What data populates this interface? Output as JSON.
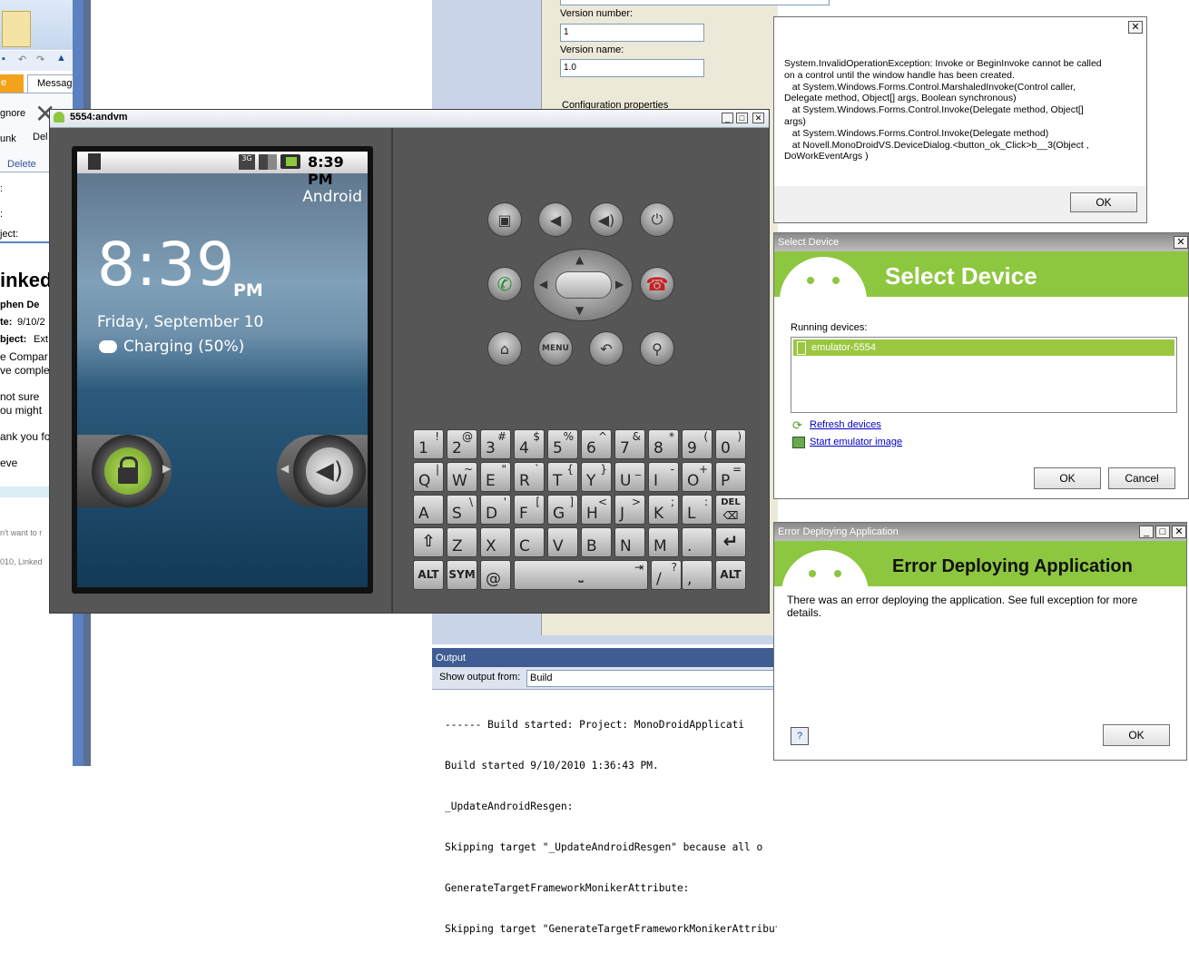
{
  "outlook": {
    "ribbon_tab": "Messag",
    "ignore_label": "gnore",
    "junk_label": "unk",
    "delete_icon_label": "Del",
    "group_delete": "Delete",
    "field_colon_1": ":",
    "field_colon_2": ":",
    "field_object": "ject:",
    "message_title": "inked",
    "from": "phen De",
    "date_label": "te:",
    "date_value": "9/10/2",
    "subject_label": "bject:",
    "subject_value": "Ext",
    "body_lines": [
      "e Compar",
      "ve comple",
      "",
      "not sure",
      "ou might",
      "",
      "ank you fo",
      "",
      "eve"
    ],
    "footer_1": "n't want to r",
    "footer_2": "010, Linked"
  },
  "project_props": {
    "version_number_label": "Version number:",
    "version_number_value": "1",
    "version_name_label": "Version name:",
    "version_name_value": "1.0",
    "config_label": "Configuration properties"
  },
  "output_pane": {
    "title": "Output",
    "show_from_label": "Show output from:",
    "show_from_value": "Build",
    "lines": [
      "------ Build started: Project: MonoDroidApplicati",
      "Build started 9/10/2010 1:36:43 PM.",
      "_UpdateAndroidResgen:",
      "Skipping target \"_UpdateAndroidResgen\" because all o",
      "GenerateTargetFrameworkMonikerAttribute:",
      "Skipping target \"GenerateTargetFrameworkMonikerAttribute\" because all output files are up-to-date with respect to the"
    ]
  },
  "emulator": {
    "window_title": "5554:andvm",
    "status_time": "8:39 PM",
    "carrier": "Android",
    "clock": "8:39",
    "ampm": "PM",
    "date": "Friday, September 10",
    "charging": "Charging (50%)",
    "menu_label": "MENU",
    "keys_row1": [
      [
        "1",
        "!"
      ],
      [
        "2",
        "@"
      ],
      [
        "3",
        "#"
      ],
      [
        "4",
        "$"
      ],
      [
        "5",
        "%"
      ],
      [
        "6",
        "^"
      ],
      [
        "7",
        "&"
      ],
      [
        "8",
        "*"
      ],
      [
        "9",
        "("
      ],
      [
        "0",
        ")"
      ]
    ],
    "keys_row2": [
      [
        "Q",
        "|"
      ],
      [
        "W",
        "~"
      ],
      [
        "E",
        "\""
      ],
      [
        "R",
        "`"
      ],
      [
        "T",
        "{"
      ],
      [
        "Y",
        "}"
      ],
      [
        "U",
        "_"
      ],
      [
        "I",
        "-"
      ],
      [
        "O",
        "+"
      ],
      [
        "P",
        "="
      ]
    ],
    "keys_row3": [
      [
        "A",
        ""
      ],
      [
        "S",
        "\\"
      ],
      [
        "D",
        "'"
      ],
      [
        "F",
        "["
      ],
      [
        "G",
        "]"
      ],
      [
        "H",
        "<"
      ],
      [
        "J",
        ">"
      ],
      [
        "K",
        ";"
      ],
      [
        "L",
        ":"
      ]
    ],
    "keys_row4": [
      "Z",
      "X",
      "C",
      "V",
      "B",
      "N",
      "M",
      "."
    ],
    "del_label": "DEL",
    "alt_label": "ALT",
    "sym_label": "SYM",
    "at_label": "@",
    "slash_main": "/",
    "slash_alt": "?",
    "comma": ","
  },
  "exception_dialog": {
    "lines": [
      "System.InvalidOperationException: Invoke or BeginInvoke cannot be called",
      "on a control until the window handle has been created.",
      "   at System.Windows.Forms.Control.MarshaledInvoke(Control caller,",
      "Delegate method, Object[] args, Boolean synchronous)",
      "   at System.Windows.Forms.Control.Invoke(Delegate method, Object[]",
      "args)",
      "   at System.Windows.Forms.Control.Invoke(Delegate method)",
      "   at Novell.MonoDroidVS.DeviceDialog.<button_ok_Click>b__3(Object ,",
      "DoWorkEventArgs )"
    ],
    "ok_label": "OK"
  },
  "select_device": {
    "window_title": "Select Device",
    "header": "Select Device",
    "running_label": "Running devices:",
    "devices": [
      "emulator-5554"
    ],
    "refresh_label": "Refresh devices",
    "start_label": "Start emulator image",
    "ok_label": "OK",
    "cancel_label": "Cancel"
  },
  "error_dialog": {
    "window_title": "Error Deploying Application",
    "header": "Error Deploying Application",
    "message": "There was an error deploying the application.  See full exception for more details.",
    "ok_label": "OK"
  },
  "colors": {
    "android_green": "#8dc63f",
    "vs_blue": "#3f5d93",
    "selection_green": "#9ac73f"
  }
}
